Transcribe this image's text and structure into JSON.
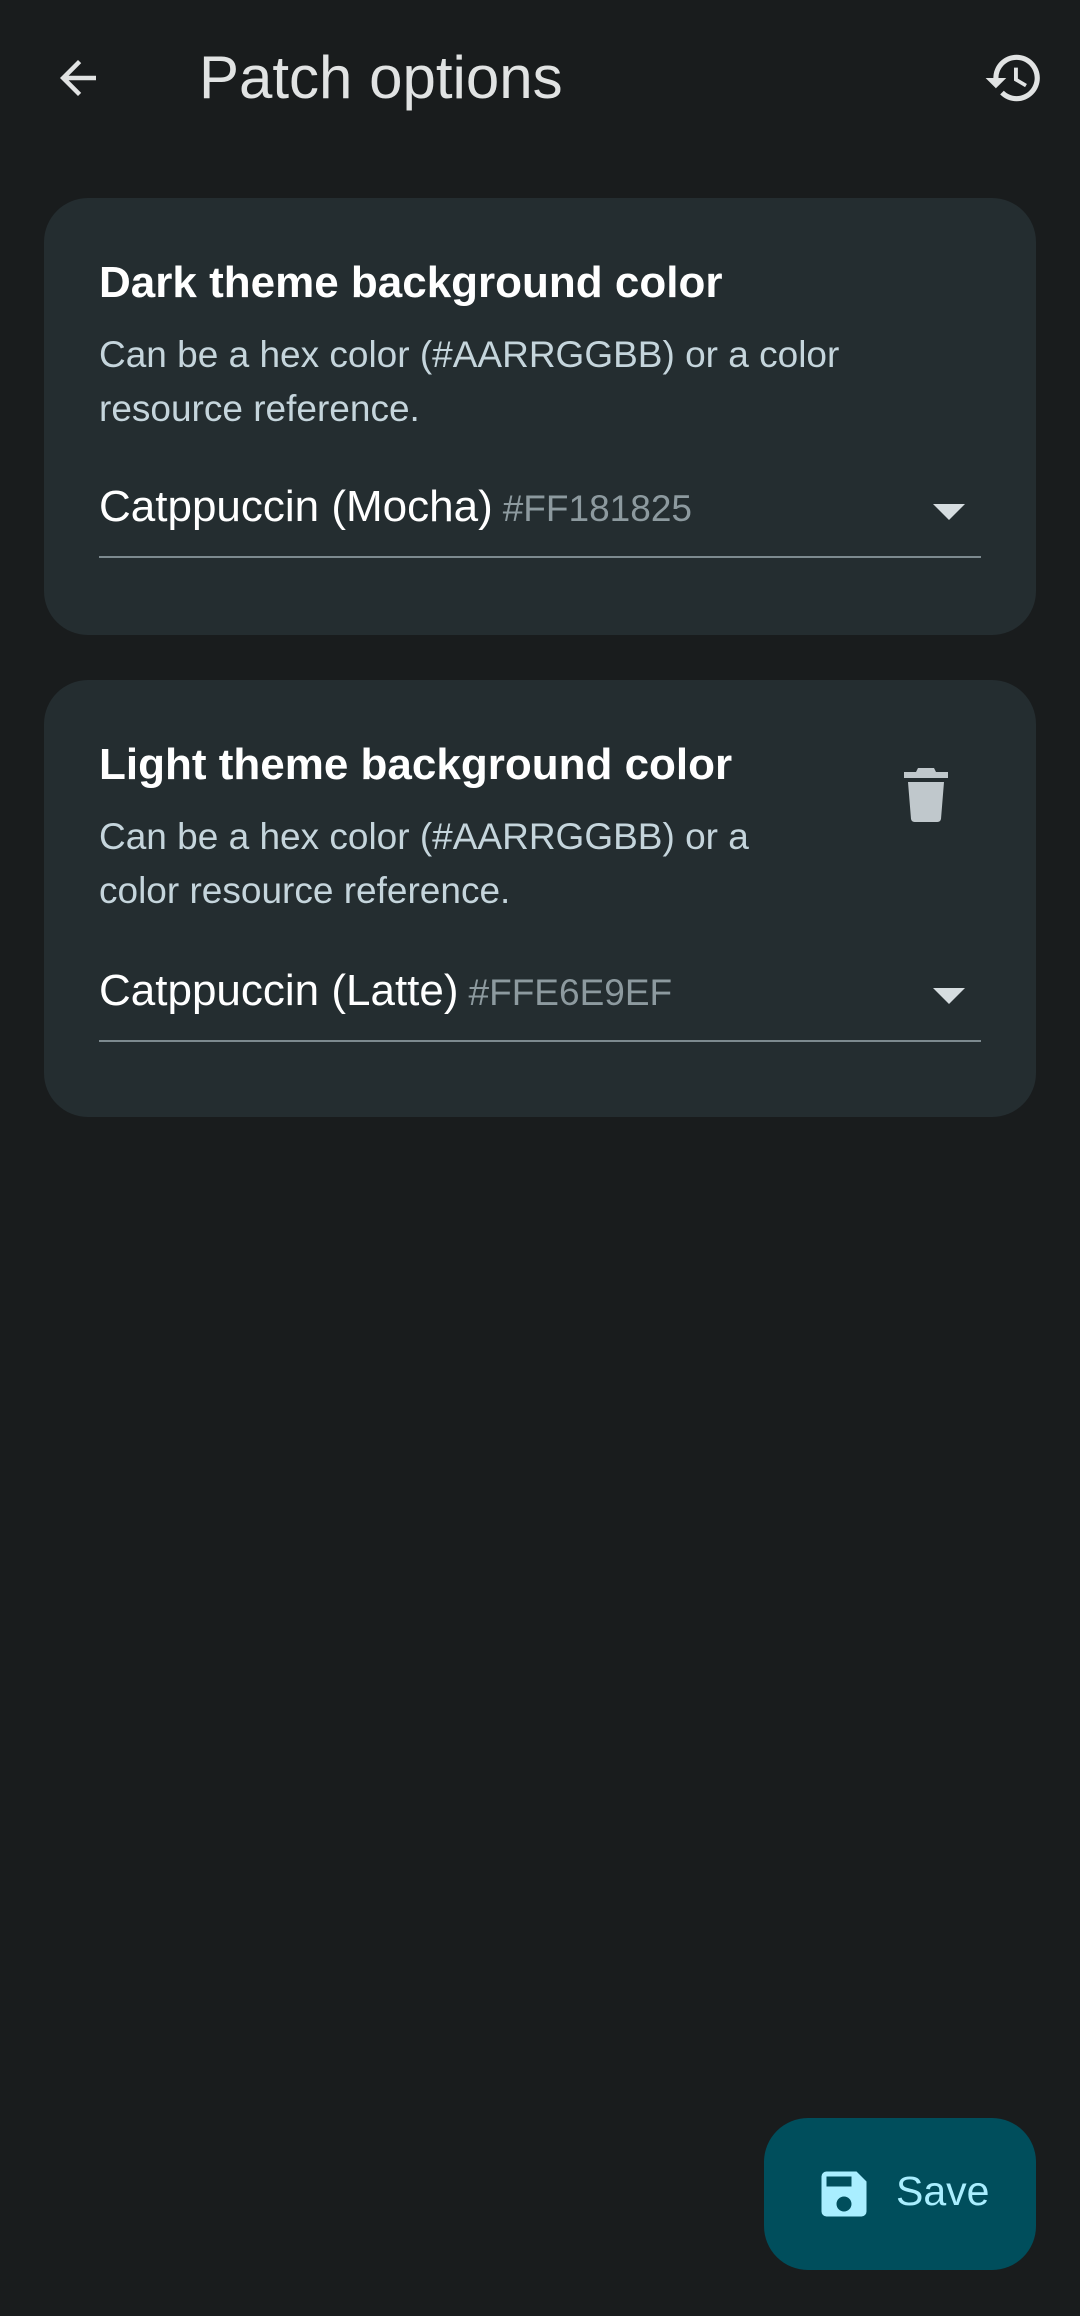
{
  "header": {
    "title": "Patch options",
    "back_icon": "arrow-back-icon",
    "history_icon": "history-icon"
  },
  "options": [
    {
      "title": "Dark theme background color",
      "description": "Can be a hex color (#AARRGGBB) or a color resource reference.",
      "selected_label": "Catppuccin (Mocha)",
      "selected_hex": "#FF181825",
      "has_delete": false
    },
    {
      "title": "Light theme background color",
      "description": "Can be a hex color (#AARRGGBB) or a color resource reference.",
      "selected_label": "Catppuccin (Latte)",
      "selected_hex": "#FFE6E9EF",
      "has_delete": true,
      "delete_icon": "trash-icon"
    }
  ],
  "fab": {
    "label": "Save",
    "icon": "save-icon"
  },
  "colors": {
    "background": "#191c1d",
    "card": "#242d30",
    "fab_background": "#004e5c",
    "fab_foreground": "#a9eeff"
  }
}
